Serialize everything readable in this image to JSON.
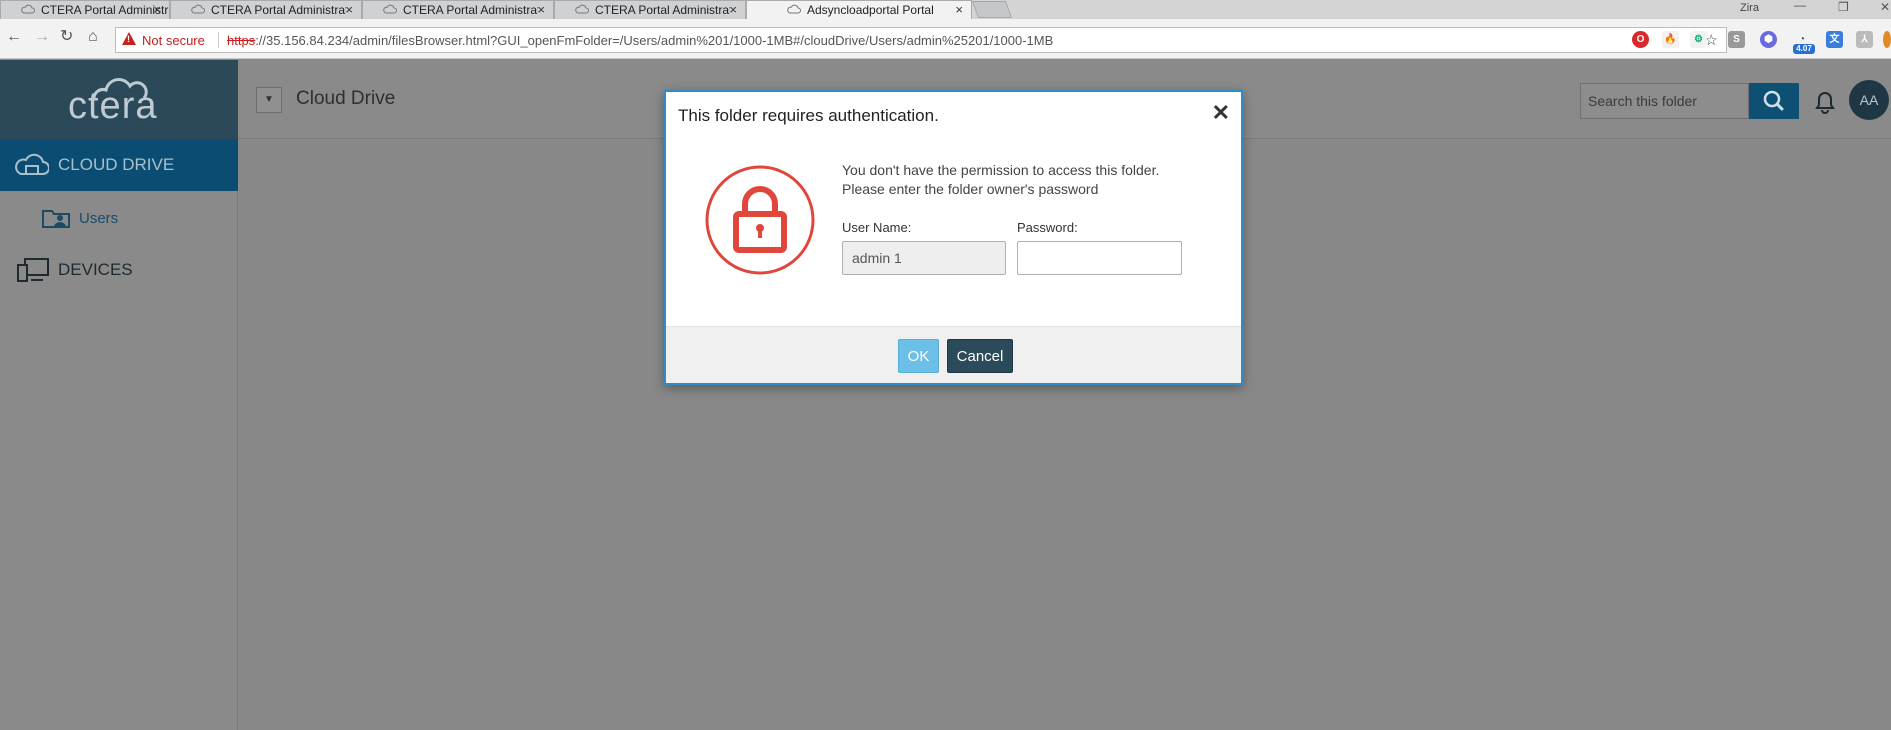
{
  "browser": {
    "tabs": [
      {
        "title": "CTERA Portal Administrat",
        "active": false
      },
      {
        "title": "CTERA Portal Administrat",
        "active": false
      },
      {
        "title": "CTERA Portal Administrat",
        "active": false
      },
      {
        "title": "CTERA Portal Administrat",
        "active": false
      },
      {
        "title": "Adsyncloadportal Portal",
        "active": true
      }
    ],
    "tab_close_glyph": "×",
    "profile_name": "Zira",
    "security_label": "Not secure",
    "url_scheme": "https",
    "url_rest": "://35.156.84.234/admin/filesBrowser.html?GUI_openFmFolder=/Users/admin%201/1000-1MB#/cloudDrive/Users/admin%25201/1000-1MB",
    "extension_badge": "4.07"
  },
  "app": {
    "logo_text": "ctera",
    "header_title": "Cloud Drive",
    "search_placeholder": "Search this folder",
    "avatar_initials": "AA",
    "accent_color": "#0b4d72"
  },
  "sidebar": {
    "items": [
      {
        "label": "CLOUD DRIVE",
        "icon": "cloud-drive-icon",
        "active": true
      },
      {
        "label": "Users",
        "icon": "users-folder-icon",
        "active": false
      },
      {
        "label": "DEVICES",
        "icon": "devices-icon",
        "active": false
      }
    ]
  },
  "dialog": {
    "title": "This folder requires authentication.",
    "close_glyph": "✕",
    "message_line1": "You don't have the permission to access this folder.",
    "message_line2": "Please enter the folder owner's password",
    "username_label": "User Name:",
    "username_value": "admin 1",
    "password_label": "Password:",
    "password_value": "",
    "ok_label": "OK",
    "cancel_label": "Cancel",
    "lock_color": "#e0473a"
  }
}
